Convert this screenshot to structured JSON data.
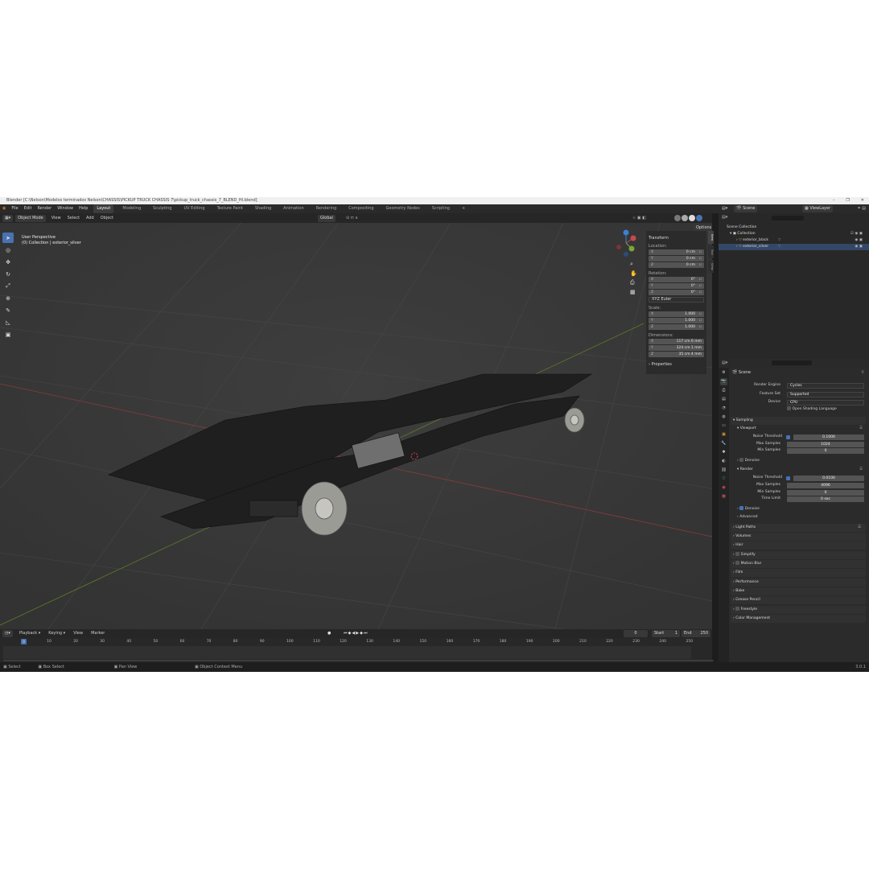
{
  "window": {
    "title": "Blender [C:\\Nelson\\Modelos terminados Nelson\\CHASSIS\\PICKUP TRUCK CHASSIS 7\\pickup_truck_chassis_7_BLEND_HI.blend]",
    "controls": [
      "–",
      "❐",
      "✕"
    ]
  },
  "menu": {
    "items": [
      "File",
      "Edit",
      "Render",
      "Window",
      "Help"
    ],
    "workspaces": [
      "Layout",
      "Modeling",
      "Sculpting",
      "UV Editing",
      "Texture Paint",
      "Shading",
      "Animation",
      "Rendering",
      "Compositing",
      "Geometry Nodes",
      "Scripting"
    ],
    "active_workspace": "Layout",
    "add_tab": "+"
  },
  "viewport_header": {
    "mode": "Object Mode",
    "menus": [
      "View",
      "Select",
      "Add",
      "Object"
    ],
    "orientation": "Global",
    "options": "Options"
  },
  "viewport": {
    "view_name": "User Perspective",
    "collection_info": "(0) Collection | exterior_silver",
    "bg_color": "#3a3a3a"
  },
  "npanel": {
    "transform_title": "Transform",
    "location_label": "Location:",
    "location": [
      {
        "axis": "X",
        "value": "0 cm"
      },
      {
        "axis": "Y",
        "value": "0 cm"
      },
      {
        "axis": "Z",
        "value": "0 cm"
      }
    ],
    "rotation_label": "Rotation:",
    "rotation": [
      {
        "axis": "X",
        "value": "0°"
      },
      {
        "axis": "Y",
        "value": "0°"
      },
      {
        "axis": "Z",
        "value": "0°"
      }
    ],
    "rotation_mode": "XYZ Euler",
    "scale_label": "Scale:",
    "scale": [
      {
        "axis": "X",
        "value": "1.000"
      },
      {
        "axis": "Y",
        "value": "1.000"
      },
      {
        "axis": "Z",
        "value": "1.000"
      }
    ],
    "dimensions_label": "Dimensions:",
    "dimensions": [
      {
        "axis": "X",
        "value": "117 cm 6 mm"
      },
      {
        "axis": "Y",
        "value": "324 cm 1 mm"
      },
      {
        "axis": "Z",
        "value": "35 cm 4 mm"
      }
    ],
    "properties": "Properties",
    "side_tabs": [
      "Item",
      "Tool",
      "View"
    ]
  },
  "outliner": {
    "scene": "Scene",
    "view_layer": "ViewLayer",
    "root": "Scene Collection",
    "collection": "Collection",
    "objects": [
      "exterior_black",
      "exterior_silver"
    ]
  },
  "properties": {
    "context": "Scene",
    "render_engine_label": "Render Engine",
    "render_engine": "Cycles",
    "feature_set_label": "Feature Set",
    "feature_set": "Supported",
    "device_label": "Device",
    "device": "CPU",
    "osl": "Open Shading Language",
    "sampling": "Sampling",
    "viewport": "Viewport",
    "noise_threshold_label": "Noise Threshold",
    "vp_noise": "0.1000",
    "max_samples_label": "Max Samples",
    "vp_max": "1024",
    "min_samples_label": "Min Samples",
    "vp_min": "0",
    "denoise": "Denoise",
    "render": "Render",
    "r_noise": "0.0100",
    "r_max": "4096",
    "r_min": "0",
    "time_limit_label": "Time Limit",
    "r_time": "0 sec",
    "advanced": "Advanced",
    "sections": [
      "Light Paths",
      "Volumes",
      "Hair",
      "Simplify",
      "Motion Blur",
      "Film",
      "Performance",
      "Bake",
      "Grease Pencil",
      "Freestyle",
      "Color Management"
    ]
  },
  "timeline": {
    "menus": [
      "Playback",
      "Keying",
      "View",
      "Marker"
    ],
    "current_frame": "0",
    "start_label": "Start",
    "start": "1",
    "end_label": "End",
    "end": "250",
    "ticks": [
      "0",
      "10",
      "20",
      "30",
      "40",
      "50",
      "60",
      "70",
      "80",
      "90",
      "100",
      "110",
      "120",
      "130",
      "140",
      "150",
      "160",
      "170",
      "180",
      "190",
      "200",
      "210",
      "220",
      "230",
      "240",
      "250"
    ]
  },
  "statusbar": {
    "items": [
      "Select",
      "Box Select",
      "Pan View",
      "Object Context Menu"
    ],
    "version": "3.0.1"
  },
  "colors": {
    "accent": "#4772b3",
    "x_axis": "#c8484f",
    "y_axis": "#7da53a",
    "z_axis": "#3d7fd1"
  },
  "icons": [
    "blender-logo-icon",
    "cursor-icon",
    "move-icon",
    "rotate-icon",
    "scale-icon",
    "transform-icon",
    "annotate-icon",
    "measure-icon",
    "add-cube-icon",
    "zoom-icon",
    "hand-icon",
    "camera-icon",
    "grid-icon",
    "eye-icon",
    "camera-visibility-icon",
    "play-icon"
  ]
}
